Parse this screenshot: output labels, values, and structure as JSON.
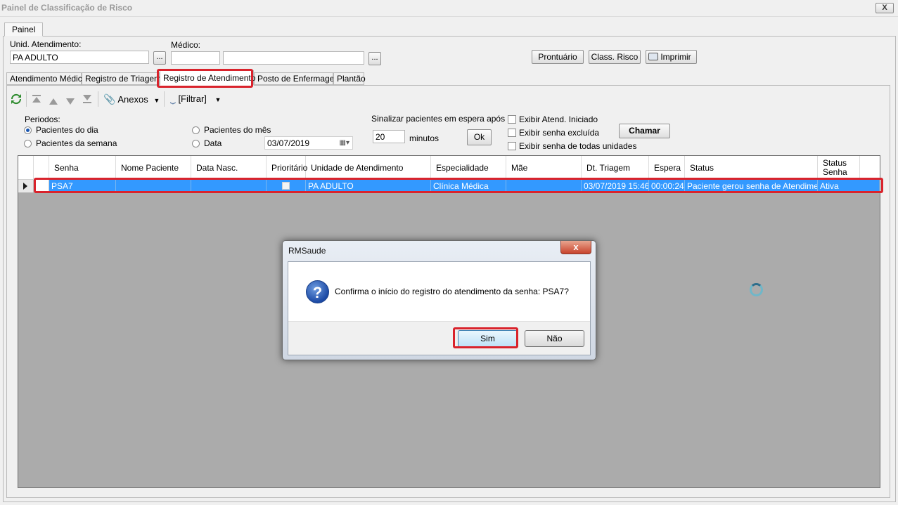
{
  "window": {
    "title": "Painel de Classificação de Risco",
    "close_label": "X"
  },
  "outer_tab": {
    "label": "Painel"
  },
  "header": {
    "unid_label": "Unid. Atendimento:",
    "unid_value": "PA ADULTO",
    "medico_label": "Médico:",
    "medico_code": "",
    "medico_name": "",
    "dots_label": "...",
    "prontuario_label": "Prontuário",
    "class_risco_label": "Class. Risco",
    "imprimir_label": "Imprimir"
  },
  "inner_tabs": [
    {
      "label": "Atendimento Médico"
    },
    {
      "label": "Registro de Triagem"
    },
    {
      "label": "Registro de Atendimento"
    },
    {
      "label": "Posto de Enfermagem"
    },
    {
      "label": "Plantão"
    }
  ],
  "toolbar": {
    "anexos_label": "Anexos",
    "filtrar_label": "[Filtrar]"
  },
  "filters": {
    "periodos_label": "Periodos:",
    "pacientes_dia": "Pacientes do dia",
    "pacientes_semana": "Pacientes da semana",
    "pacientes_mes": "Pacientes do mês",
    "data_label": "Data",
    "data_value": "03/07/2019",
    "sinalizar_label": "Sinalizar pacientes em espera após",
    "minutos_value": "20",
    "minutos_label": "minutos",
    "ok_label": "Ok",
    "exibir_atend": "Exibir Atend. Iniciado",
    "exibir_senha_excluida": "Exibir senha excluída",
    "exibir_todas": "Exibir senha de todas unidades",
    "chamar_label": "Chamar"
  },
  "grid": {
    "columns": [
      "Senha",
      "Nome Paciente",
      "Data Nasc.",
      "Prioritário",
      "Unidade de Atendimento",
      "Especialidade",
      "Mãe",
      "Dt. Triagem",
      "Espera",
      "Status",
      "Status Senha"
    ],
    "rows": [
      {
        "senha": "PSA7",
        "nome": "",
        "data_nasc": "",
        "prioritario": false,
        "unidade": "PA ADULTO",
        "especialidade": "Clínica Médica",
        "mae": "",
        "dt_triagem": "03/07/2019 15:46",
        "espera": "00:00:24",
        "status": "Paciente gerou senha de Atendimento",
        "status_senha": "Ativa"
      }
    ]
  },
  "dialog": {
    "title": "RMSaude",
    "message": "Confirma o início do registro do atendimento da senha: PSA7?",
    "yes_label": "Sim",
    "no_label": "Não",
    "close_label": "x"
  },
  "colors": {
    "selection": "#3399ff",
    "highlight": "#d9232c",
    "grid_background": "#ababab"
  }
}
